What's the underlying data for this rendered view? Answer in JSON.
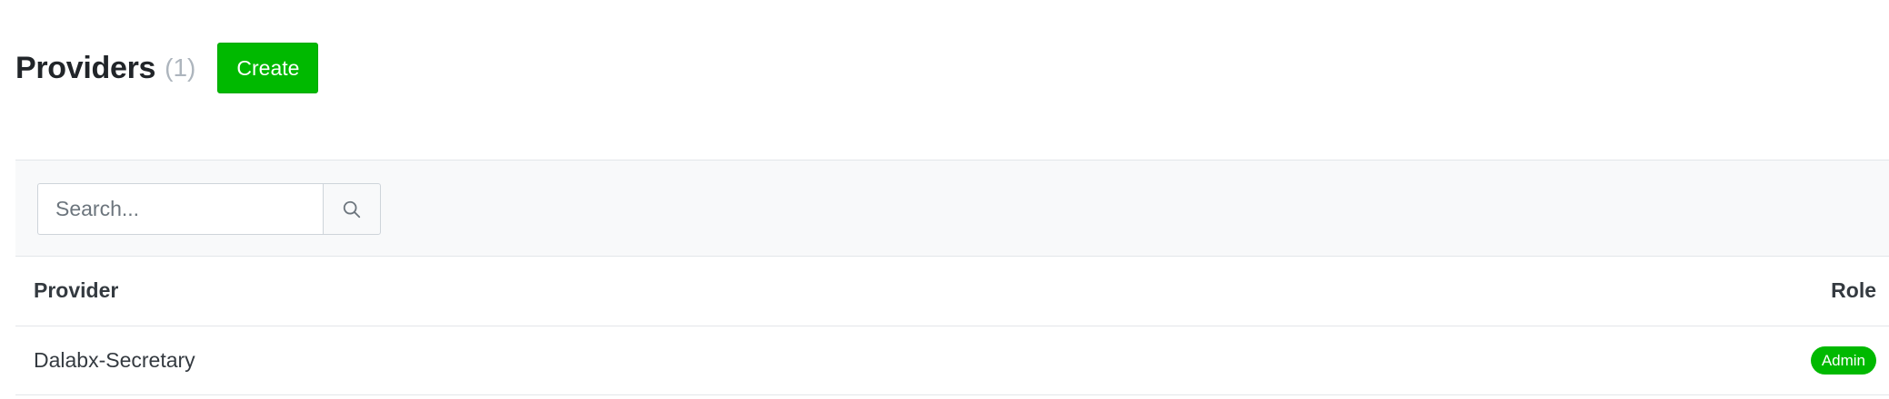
{
  "header": {
    "title": "Providers",
    "count": "(1)",
    "create_label": "Create"
  },
  "search": {
    "placeholder": "Search...",
    "value": "",
    "icon": "search-icon"
  },
  "table": {
    "columns": [
      "Provider",
      "Role"
    ],
    "rows": [
      {
        "provider": "Dalabx-Secretary",
        "role": "Admin"
      }
    ]
  },
  "colors": {
    "primary_green": "#00b900",
    "muted_count": "#adb5bd",
    "toolbar_bg": "#f8f9fa"
  }
}
